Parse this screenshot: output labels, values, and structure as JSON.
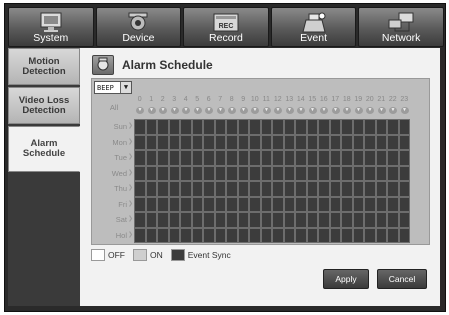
{
  "tabs": [
    {
      "label": "System",
      "icon": "monitor-icon",
      "active": true
    },
    {
      "label": "Device",
      "icon": "camera-icon",
      "active": false
    },
    {
      "label": "Record",
      "icon": "record-icon",
      "active": false
    },
    {
      "label": "Event",
      "icon": "event-icon",
      "active": false
    },
    {
      "label": "Network",
      "icon": "network-icon",
      "active": false
    }
  ],
  "sidebar": {
    "items": [
      {
        "label": "Motion Detection"
      },
      {
        "label": "Video Loss Detection"
      },
      {
        "label": "Alarm Schedule",
        "active": true
      }
    ]
  },
  "page": {
    "title": "Alarm Schedule",
    "icon": "alarm-schedule-icon"
  },
  "schedule": {
    "dropdown_value": "BEEP",
    "all_label": "All",
    "hours": [
      "0",
      "1",
      "2",
      "3",
      "4",
      "5",
      "6",
      "7",
      "8",
      "9",
      "10",
      "11",
      "12",
      "13",
      "14",
      "15",
      "16",
      "17",
      "18",
      "19",
      "20",
      "21",
      "22",
      "23"
    ],
    "days": [
      "Sun",
      "Mon",
      "Tue",
      "Wed",
      "Thu",
      "Fri",
      "Sat",
      "Hol"
    ],
    "cell_state": "Event Sync"
  },
  "legend": {
    "off": "OFF",
    "on": "ON",
    "sync": "Event Sync"
  },
  "buttons": {
    "apply": "Apply",
    "cancel": "Cancel"
  },
  "colors": {
    "sync": "#3c3c3c",
    "on": "#cfcfcf",
    "off": "#ffffff"
  }
}
